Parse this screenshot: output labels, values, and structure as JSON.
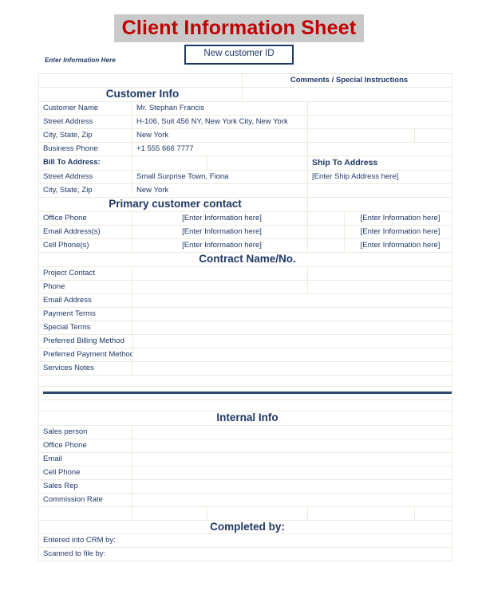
{
  "header": {
    "title": "Client Information Sheet",
    "id_box_label": "New customer ID",
    "enter_info_here": "Enter Information Here"
  },
  "colors": {
    "title_text": "#c00000",
    "title_background": "#c9c9c9",
    "body_text": "#1f3864",
    "border": "#ebebdf",
    "divider_bar": "#2e4a6b"
  },
  "table": {
    "comments_header": "Comments / Special Instructions",
    "sections": {
      "customer_info": "Customer Info",
      "primary_contact": "Primary customer contact",
      "contract": "Contract Name/No.",
      "internal_info": "Internal Info",
      "completed_by": "Completed by:"
    },
    "customer_info_rows": [
      {
        "label": "Customer Name",
        "value": "Mr. Stephan Francis"
      },
      {
        "label": "Street Address",
        "value": "H-106, Suit 456 NY, New York City, New York"
      },
      {
        "label": "City, State, Zip",
        "value": "New York"
      },
      {
        "label": "Business Phone",
        "value": "+1 555 666 7777"
      }
    ],
    "bill_to_label": "Bill To Address:",
    "bill_to_rows": [
      {
        "label": "Street Address",
        "value": "Small Surprise Town, Fiona"
      },
      {
        "label": "City, State, Zip",
        "value": "New York"
      }
    ],
    "ship_to": {
      "label": "Ship To Address",
      "value": "[Enter Ship Address here]"
    },
    "primary_contact_rows": [
      {
        "label": "Office Phone",
        "value": "[Enter Information here]",
        "comment": "[Enter Information here]"
      },
      {
        "label": "Email Address(s)",
        "value": "[Enter Information here]",
        "comment": "[Enter Information here]"
      },
      {
        "label": "Cell Phone(s)",
        "value": "[Enter Information here]",
        "comment": "[Enter Information here]"
      }
    ],
    "contract_rows": [
      {
        "label": "Project Contact",
        "value": ""
      },
      {
        "label": "Phone",
        "value": ""
      },
      {
        "label": "Email Address",
        "value": ""
      },
      {
        "label": "Payment Terms",
        "value": ""
      },
      {
        "label": "Special Terms",
        "value": ""
      }
    ],
    "contract_wide_rows": [
      {
        "label": "Preferred Billing Method",
        "value": ""
      },
      {
        "label": "Preferred Payment Method",
        "value": ""
      }
    ],
    "services_notes": {
      "label": "Services Notes",
      "value": ""
    },
    "internal_info_rows": [
      {
        "label": "Sales person",
        "value": ""
      },
      {
        "label": "Office Phone",
        "value": ""
      },
      {
        "label": "Email",
        "value": ""
      },
      {
        "label": "Cell Phone",
        "value": ""
      },
      {
        "label": "Sales Rep",
        "value": ""
      },
      {
        "label": "Commission Rate",
        "value": ""
      }
    ],
    "completed_by_rows": [
      {
        "label": "Entered into CRM by:",
        "value": ""
      },
      {
        "label": "Scanned to file by:",
        "value": ""
      }
    ]
  }
}
